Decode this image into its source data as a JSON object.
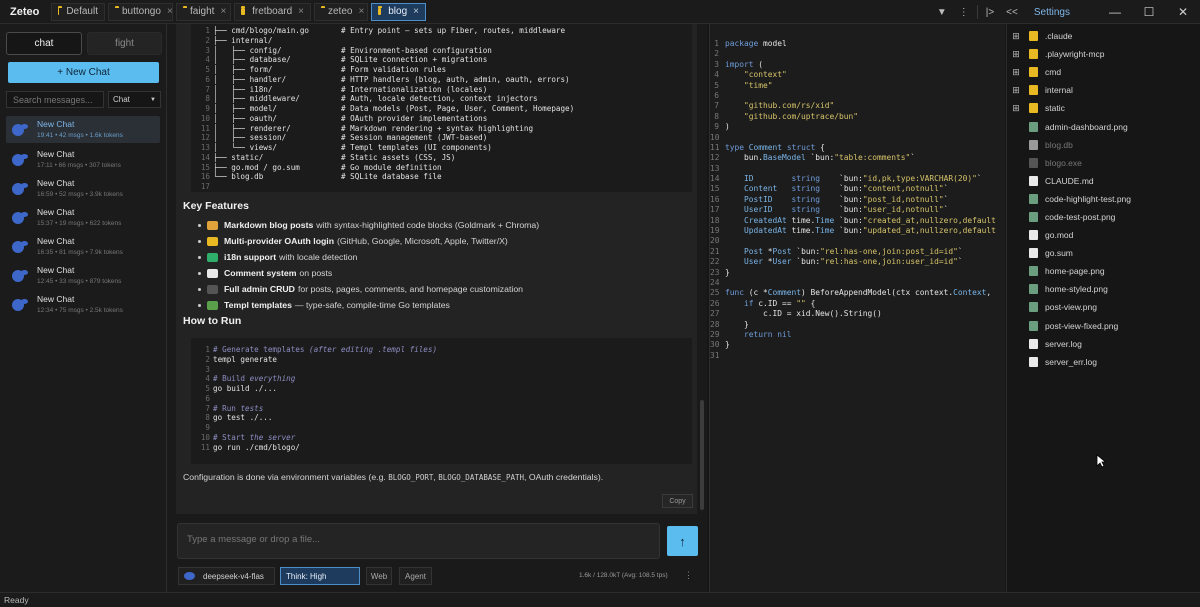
{
  "app": {
    "title": "Zeteo"
  },
  "tabs": [
    {
      "label": "Default",
      "close": ""
    },
    {
      "label": "buttongo",
      "close": "×"
    },
    {
      "label": "faight",
      "close": "×"
    },
    {
      "label": "fretboard",
      "close": "×"
    },
    {
      "label": "zeteo",
      "close": "×"
    },
    {
      "label": "blog",
      "close": "×"
    }
  ],
  "topbar": {
    "dropdown": "▼",
    "more": "⋮",
    "collapse_right": "|>",
    "collapse_left": "<<",
    "settings": "Settings",
    "minimize": "—",
    "maximize": "☐",
    "close": "✕"
  },
  "sidebar": {
    "mode_chat": "chat",
    "mode_fight": "fight",
    "new_chat": "+ New Chat",
    "search_placeholder": "Search messages...",
    "filter": "Chat",
    "filter_arrow": "▼",
    "chats": [
      {
        "title": "New Chat",
        "meta": "19:41 • 42 msgs • 1.6k tokens"
      },
      {
        "title": "New Chat",
        "meta": "17:11 • 66 msgs • 307 tokens"
      },
      {
        "title": "New Chat",
        "meta": "16:59 • 52 msgs • 3.9k tokens"
      },
      {
        "title": "New Chat",
        "meta": "15:37 • 19 msgs • 622 tokens"
      },
      {
        "title": "New Chat",
        "meta": "16:35 • 81 msgs • 7.9k tokens"
      },
      {
        "title": "New Chat",
        "meta": "12:45 • 33 msgs • 879 tokens"
      },
      {
        "title": "New Chat",
        "meta": "12:34 • 75 msgs • 2.5k tokens"
      }
    ]
  },
  "message": {
    "structure_lines": [
      {
        "n": "1",
        "t": "├── cmd/blogo/main.go       # Entry point — sets up Fiber, routes, middleware"
      },
      {
        "n": "2",
        "t": "├── internal/"
      },
      {
        "n": "3",
        "t": "│   ├── config/             # Environment-based configuration"
      },
      {
        "n": "4",
        "t": "│   ├── database/           # SQLite connection + migrations"
      },
      {
        "n": "5",
        "t": "│   ├── form/               # Form validation rules"
      },
      {
        "n": "6",
        "t": "│   ├── handler/            # HTTP handlers (blog, auth, admin, oauth, errors)"
      },
      {
        "n": "7",
        "t": "│   ├── i18n/               # Internationalization (locales)"
      },
      {
        "n": "8",
        "t": "│   ├── middleware/         # Auth, locale detection, context injectors"
      },
      {
        "n": "9",
        "t": "│   ├── model/              # Data models (Post, Page, User, Comment, Homepage)"
      },
      {
        "n": "10",
        "t": "│   ├── oauth/              # OAuth provider implementations"
      },
      {
        "n": "11",
        "t": "│   ├── renderer/           # Markdown rendering + syntax highlighting"
      },
      {
        "n": "12",
        "t": "│   ├── session/            # Session management (JWT-based)"
      },
      {
        "n": "13",
        "t": "│   └── views/              # Templ templates (UI components)"
      },
      {
        "n": "14",
        "t": "├── static/                 # Static assets (CSS, JS)"
      },
      {
        "n": "15",
        "t": "├── go.mod / go.sum         # Go module definition"
      },
      {
        "n": "16",
        "t": "└── blog.db                 # SQLite database file"
      },
      {
        "n": "17",
        "t": ""
      }
    ],
    "key_features_title": "Key Features",
    "features": [
      {
        "bold": "Markdown blog posts",
        "rest": "with syntax-highlighted code blocks (Goldmark + Chroma)",
        "color": "#e0a23a"
      },
      {
        "bold": "Multi-provider OAuth login",
        "rest": "(GitHub, Google, Microsoft, Apple, Twitter/X)",
        "color": "#e8b923"
      },
      {
        "bold": "i18n support",
        "rest": "with locale detection",
        "color": "#2fae6b"
      },
      {
        "bold": "Comment system",
        "rest": "on posts",
        "color": "#e9e9e9"
      },
      {
        "bold": "Full admin CRUD",
        "rest": "for posts, pages, comments, and homepage customization",
        "color": "#555555"
      },
      {
        "bold": "Templ templates",
        "rest": "— type-safe, compile-time Go templates",
        "color": "#5aa04a"
      }
    ],
    "how_to_run_title": "How to Run",
    "run_lines": [
      {
        "n": "1",
        "c": "# Generate templates ",
        "ci": "(after editing .templ files)",
        "t": ""
      },
      {
        "n": "2",
        "c": "",
        "ci": "",
        "t": "templ generate"
      },
      {
        "n": "3",
        "c": "",
        "ci": "",
        "t": ""
      },
      {
        "n": "4",
        "c": "# Build ",
        "ci": "everything",
        "t": ""
      },
      {
        "n": "5",
        "c": "",
        "ci": "",
        "t": "go build ./..."
      },
      {
        "n": "6",
        "c": "",
        "ci": "",
        "t": ""
      },
      {
        "n": "7",
        "c": "# Run ",
        "ci": "tests",
        "t": ""
      },
      {
        "n": "8",
        "c": "",
        "ci": "",
        "t": "go test ./..."
      },
      {
        "n": "9",
        "c": "",
        "ci": "",
        "t": ""
      },
      {
        "n": "10",
        "c": "# Start ",
        "ci": "the server",
        "t": ""
      },
      {
        "n": "11",
        "c": "",
        "ci": "",
        "t": "go run ./cmd/blogo/"
      }
    ],
    "config_prefix": "Configuration is done via environment variables (e.g. ",
    "config_var1": "BLOGO_PORT",
    "config_sep1": ", ",
    "config_var2": "BLOGO_DATABASE_PATH",
    "config_suffix": ", OAuth credentials).",
    "copy": "Copy"
  },
  "composer": {
    "placeholder": "Type a message or drop a file...",
    "send": "↑",
    "model": "deepseek-v4-flas",
    "think": "Think: High",
    "web": "Web",
    "agent": "Agent",
    "stats": "1.6k / 128.0kT (Avg: 108.5 tps)",
    "more": "⋮"
  },
  "editor": {
    "lines": [
      {
        "n": "1",
        "p": [
          [
            "kw",
            "package"
          ],
          [
            "plain",
            " model"
          ]
        ]
      },
      {
        "n": "2",
        "p": []
      },
      {
        "n": "3",
        "p": [
          [
            "kw",
            "import"
          ],
          [
            "plain",
            " ("
          ]
        ]
      },
      {
        "n": "4",
        "p": [
          [
            "plain",
            "    "
          ],
          [
            "str",
            "\"context\""
          ]
        ]
      },
      {
        "n": "5",
        "p": [
          [
            "plain",
            "    "
          ],
          [
            "str",
            "\"time\""
          ]
        ]
      },
      {
        "n": "6",
        "p": []
      },
      {
        "n": "7",
        "p": [
          [
            "plain",
            "    "
          ],
          [
            "str",
            "\"github.com/rs/xid\""
          ]
        ]
      },
      {
        "n": "8",
        "p": [
          [
            "plain",
            "    "
          ],
          [
            "str",
            "\"github.com/uptrace/bun\""
          ]
        ]
      },
      {
        "n": "9",
        "p": [
          [
            "plain",
            ")"
          ]
        ]
      },
      {
        "n": "10",
        "p": []
      },
      {
        "n": "11",
        "p": [
          [
            "kw",
            "type"
          ],
          [
            "plain",
            " "
          ],
          [
            "tp",
            "Comment"
          ],
          [
            "plain",
            " "
          ],
          [
            "kw",
            "struct"
          ],
          [
            "plain",
            " {"
          ]
        ]
      },
      {
        "n": "12",
        "p": [
          [
            "plain",
            "    bun."
          ],
          [
            "tp",
            "BaseModel"
          ],
          [
            "plain",
            " `bun:"
          ],
          [
            "str",
            "\"table:comments\""
          ],
          [
            "plain",
            "`"
          ]
        ]
      },
      {
        "n": "13",
        "p": []
      },
      {
        "n": "14",
        "p": [
          [
            "plain",
            "    "
          ],
          [
            "tp",
            "ID"
          ],
          [
            "plain",
            "        "
          ],
          [
            "kw",
            "string"
          ],
          [
            "plain",
            "    `bun:"
          ],
          [
            "str",
            "\"id,pk,type:VARCHAR(20)\""
          ],
          [
            "plain",
            "`"
          ]
        ]
      },
      {
        "n": "15",
        "p": [
          [
            "plain",
            "    "
          ],
          [
            "tp",
            "Content"
          ],
          [
            "plain",
            "   "
          ],
          [
            "kw",
            "string"
          ],
          [
            "plain",
            "    `bun:"
          ],
          [
            "str",
            "\"content,notnull\""
          ],
          [
            "plain",
            "`"
          ]
        ]
      },
      {
        "n": "16",
        "p": [
          [
            "plain",
            "    "
          ],
          [
            "tp",
            "PostID"
          ],
          [
            "plain",
            "    "
          ],
          [
            "kw",
            "string"
          ],
          [
            "plain",
            "    `bun:"
          ],
          [
            "str",
            "\"post_id,notnull\""
          ],
          [
            "plain",
            "`"
          ]
        ]
      },
      {
        "n": "17",
        "p": [
          [
            "plain",
            "    "
          ],
          [
            "tp",
            "UserID"
          ],
          [
            "plain",
            "    "
          ],
          [
            "kw",
            "string"
          ],
          [
            "plain",
            "    `bun:"
          ],
          [
            "str",
            "\"user_id,notnull\""
          ],
          [
            "plain",
            "`"
          ]
        ]
      },
      {
        "n": "18",
        "p": [
          [
            "plain",
            "    "
          ],
          [
            "tp",
            "CreatedAt"
          ],
          [
            "plain",
            " time."
          ],
          [
            "tp",
            "Time"
          ],
          [
            "plain",
            " `bun:"
          ],
          [
            "str",
            "\"created_at,nullzero,default"
          ]
        ]
      },
      {
        "n": "19",
        "p": [
          [
            "plain",
            "    "
          ],
          [
            "tp",
            "UpdatedAt"
          ],
          [
            "plain",
            " time."
          ],
          [
            "tp",
            "Time"
          ],
          [
            "plain",
            " `bun:"
          ],
          [
            "str",
            "\"updated_at,nullzero,default"
          ]
        ]
      },
      {
        "n": "20",
        "p": []
      },
      {
        "n": "21",
        "p": [
          [
            "plain",
            "    "
          ],
          [
            "tp",
            "Post"
          ],
          [
            "plain",
            " *"
          ],
          [
            "tp",
            "Post"
          ],
          [
            "plain",
            " `bun:"
          ],
          [
            "str",
            "\"rel:has-one,join:post_id=id\""
          ],
          [
            "plain",
            "`"
          ]
        ]
      },
      {
        "n": "22",
        "p": [
          [
            "plain",
            "    "
          ],
          [
            "tp",
            "User"
          ],
          [
            "plain",
            " *"
          ],
          [
            "tp",
            "User"
          ],
          [
            "plain",
            " `bun:"
          ],
          [
            "str",
            "\"rel:has-one,join:user_id=id\""
          ],
          [
            "plain",
            "`"
          ]
        ]
      },
      {
        "n": "23",
        "p": [
          [
            "plain",
            "}"
          ]
        ]
      },
      {
        "n": "24",
        "p": []
      },
      {
        "n": "25",
        "p": [
          [
            "kw",
            "func"
          ],
          [
            "plain",
            " (c *"
          ],
          [
            "tp",
            "Comment"
          ],
          [
            "plain",
            ") BeforeAppendModel(ctx context."
          ],
          [
            "tp",
            "Context"
          ],
          [
            "plain",
            ","
          ]
        ]
      },
      {
        "n": "26",
        "p": [
          [
            "plain",
            "    "
          ],
          [
            "kw",
            "if"
          ],
          [
            "plain",
            " c.ID == "
          ],
          [
            "str",
            "\"\""
          ],
          [
            "plain",
            " {"
          ]
        ]
      },
      {
        "n": "27",
        "p": [
          [
            "plain",
            "        c.ID = xid.New().String()"
          ]
        ]
      },
      {
        "n": "28",
        "p": [
          [
            "plain",
            "    }"
          ]
        ]
      },
      {
        "n": "29",
        "p": [
          [
            "plain",
            "    "
          ],
          [
            "kw",
            "return"
          ],
          [
            "plain",
            " "
          ],
          [
            "kw",
            "nil"
          ]
        ]
      },
      {
        "n": "30",
        "p": [
          [
            "plain",
            "}"
          ]
        ]
      },
      {
        "n": "31",
        "p": []
      }
    ]
  },
  "filetree": {
    "items": [
      {
        "name": ".claude",
        "icon": "folder",
        "expand": "⊞",
        "dim": false
      },
      {
        "name": ".playwright-mcp",
        "icon": "folder",
        "expand": "⊞",
        "dim": false
      },
      {
        "name": "cmd",
        "icon": "folder",
        "expand": "⊞",
        "dim": false
      },
      {
        "name": "internal",
        "icon": "folder",
        "expand": "⊞",
        "dim": false
      },
      {
        "name": "static",
        "icon": "folder",
        "expand": "⊞",
        "dim": false
      },
      {
        "name": "admin-dashboard.png",
        "icon": "img",
        "expand": "",
        "dim": false
      },
      {
        "name": "blog.db",
        "icon": "db",
        "expand": "",
        "dim": true
      },
      {
        "name": "blogo.exe",
        "icon": "exe",
        "expand": "",
        "dim": true
      },
      {
        "name": "CLAUDE.md",
        "icon": "file",
        "expand": "",
        "dim": false
      },
      {
        "name": "code-highlight-test.png",
        "icon": "img",
        "expand": "",
        "dim": false
      },
      {
        "name": "code-test-post.png",
        "icon": "img",
        "expand": "",
        "dim": false
      },
      {
        "name": "go.mod",
        "icon": "file",
        "expand": "",
        "dim": false
      },
      {
        "name": "go.sum",
        "icon": "file",
        "expand": "",
        "dim": false
      },
      {
        "name": "home-page.png",
        "icon": "img",
        "expand": "",
        "dim": false
      },
      {
        "name": "home-styled.png",
        "icon": "img",
        "expand": "",
        "dim": false
      },
      {
        "name": "post-view.png",
        "icon": "img",
        "expand": "",
        "dim": false
      },
      {
        "name": "post-view-fixed.png",
        "icon": "img",
        "expand": "",
        "dim": false
      },
      {
        "name": "server.log",
        "icon": "file",
        "expand": "",
        "dim": false
      },
      {
        "name": "server_err.log",
        "icon": "file",
        "expand": "",
        "dim": false
      }
    ]
  },
  "status": {
    "text": "Ready"
  },
  "colors": {
    "accent": "#5bbcef",
    "active_tab": "#1e3a5c",
    "folder": "#e8b923"
  }
}
